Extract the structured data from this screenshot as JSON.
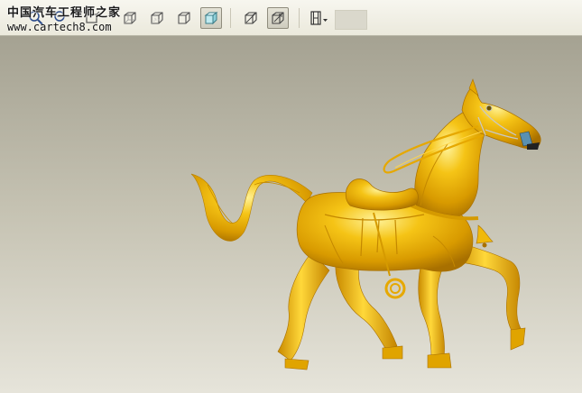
{
  "watermark": {
    "title": "中国汽车工程师之家",
    "url": "www.cartech8.com"
  },
  "toolbar": {
    "buttons": [
      {
        "name": "zoom-in-icon",
        "active": false
      },
      {
        "name": "zoom-out-icon",
        "active": false
      },
      {
        "name": "repaint-icon",
        "active": false
      },
      {
        "name": "wireframe-icon",
        "active": false
      },
      {
        "name": "hidden-line-icon",
        "active": false
      },
      {
        "name": "no-hidden-icon",
        "active": false
      },
      {
        "name": "shading-icon",
        "active": true
      },
      {
        "name": "saved-view-icon",
        "active": false
      },
      {
        "name": "named-view-icon",
        "active": true
      },
      {
        "name": "film-strip-icon",
        "active": false
      }
    ]
  },
  "viewport": {
    "model": "horse-model",
    "model_color": "#f0b90b",
    "background_top": "#a5a292",
    "background_bottom": "#e6e4da"
  }
}
